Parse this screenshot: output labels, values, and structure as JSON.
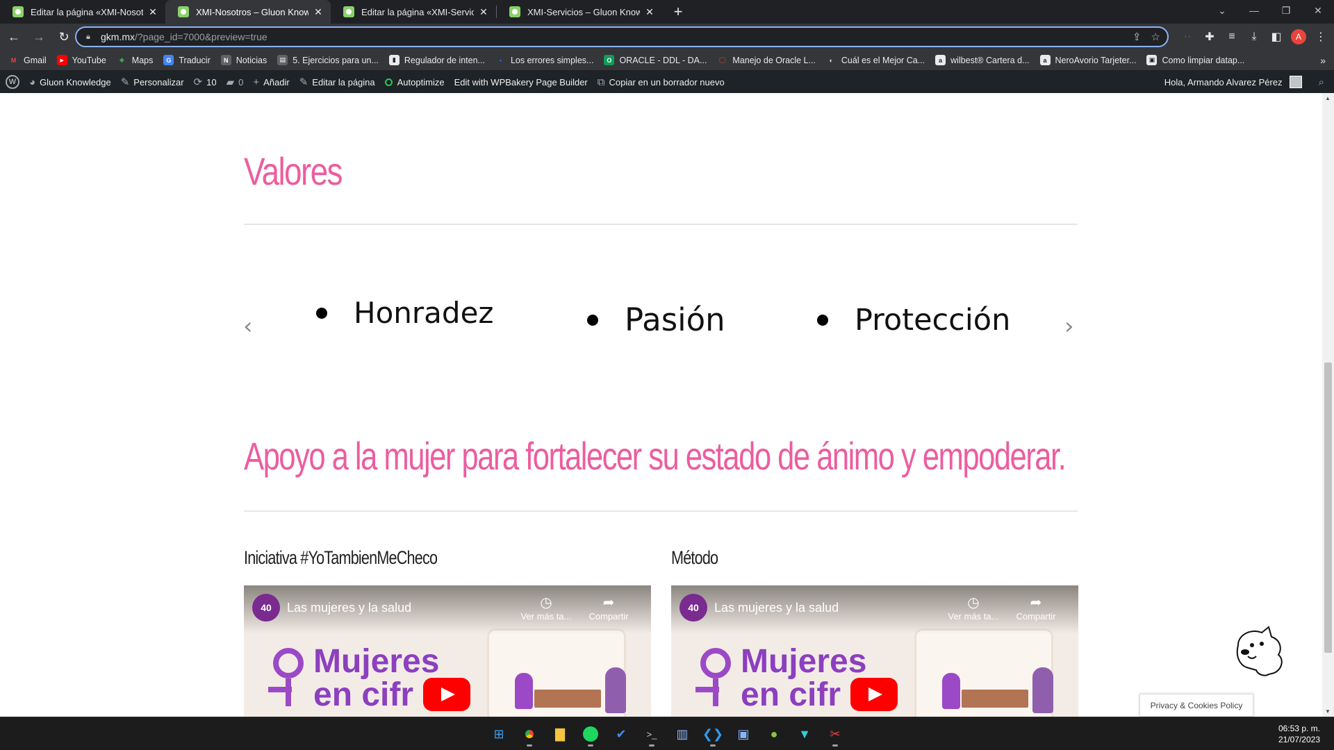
{
  "browser": {
    "tabs": [
      {
        "title": "Editar la página «XMI-Nosotros»",
        "active": false
      },
      {
        "title": "XMI-Nosotros – Gluon Knowledge",
        "active": true
      },
      {
        "title": "Editar la página «XMI-Servicios»",
        "active": false
      },
      {
        "title": "XMI-Servicios – Gluon Knowledge",
        "active": false
      }
    ],
    "new_tab": "+",
    "url_host": "gkm.mx",
    "url_path": "/?page_id=7000&preview=true",
    "avatar_letter": "A",
    "bookmarks": [
      {
        "label": "Gmail",
        "color": "#ea4335",
        "glyph": "M"
      },
      {
        "label": "YouTube",
        "color": "#ff0000",
        "glyph": "▶"
      },
      {
        "label": "Maps",
        "color": "#34a853",
        "glyph": "◆"
      },
      {
        "label": "Traducir",
        "color": "#4285f4",
        "glyph": "G"
      },
      {
        "label": "Noticias",
        "color": "#5f6368",
        "glyph": "N"
      },
      {
        "label": "5. Ejercicios para un...",
        "color": "#5f6368",
        "glyph": "▤"
      },
      {
        "label": "Regulador de inten...",
        "color": "#ffffff",
        "glyph": "▮"
      },
      {
        "label": "Los errores simples...",
        "color": "#1a73e8",
        "glyph": "▪"
      },
      {
        "label": "ORACLE - DDL - DA...",
        "color": "#0f9d58",
        "glyph": "O"
      },
      {
        "label": "Manejo de Oracle L...",
        "color": "#c74634",
        "glyph": "◯"
      },
      {
        "label": "Cuál es el Mejor Ca...",
        "color": "#ffffff",
        "glyph": "◐"
      },
      {
        "label": "wilbest® Cartera d...",
        "color": "#ffffff",
        "glyph": "a"
      },
      {
        "label": "NeroAvorio Tarjeter...",
        "color": "#ffffff",
        "glyph": "a"
      },
      {
        "label": "Como limpiar datap...",
        "color": "#ffffff",
        "glyph": "▣"
      }
    ]
  },
  "adminbar": {
    "site": "Gluon Knowledge",
    "customize": "Personalizar",
    "updates": "10",
    "comments": "0",
    "add": "Añadir",
    "edit": "Editar la página",
    "autoptimize": "Autoptimize",
    "wpbakery": "Edit with WPBakery Page Builder",
    "copy": "Copiar en un borrador nuevo",
    "greeting": "Hola, Armando Alvarez Pérez"
  },
  "page": {
    "values_heading": "Valores",
    "values": [
      "Honradez",
      "Pasión",
      "Protección"
    ],
    "support_heading": "Apoyo a la mujer para fortalecer su estado de ánimo y empoderar.",
    "videos": [
      {
        "section_title": "Iniciativa #YoTambienMeCheco",
        "video_title": "Las mujeres y la salud",
        "watch_later": "Ver más ta...",
        "share": "Compartir",
        "thumb_text_1": "Mujeres",
        "thumb_text_2": "en cifr"
      },
      {
        "section_title": "Método",
        "video_title": "Las mujeres y la salud",
        "watch_later": "Ver más ta...",
        "share": "Compartir",
        "thumb_text_1": "Mujeres",
        "thumb_text_2": "en cifr"
      }
    ],
    "privacy": "Privacy & Cookies Policy"
  },
  "taskbar": {
    "time": "06:53 p. m.",
    "date": "21/07/2023"
  },
  "colors": {
    "accent_pink": "#ec5d9f",
    "youtube_red": "#ff0000",
    "wp_admin_bg": "#1d2327"
  }
}
